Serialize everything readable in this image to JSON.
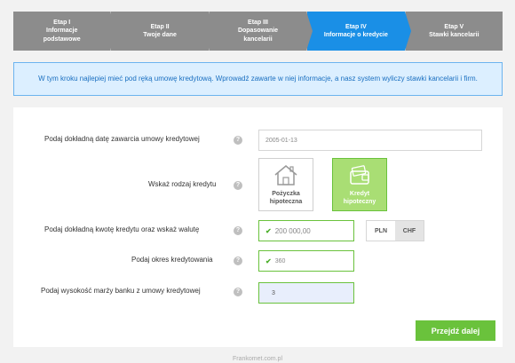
{
  "steps": [
    {
      "num": "Etap I",
      "title": "Informacje podstawowe"
    },
    {
      "num": "Etap II",
      "title": "Twoje dane"
    },
    {
      "num": "Etap III",
      "title": "Dopasowanie kancelarii"
    },
    {
      "num": "Etap IV",
      "title": "Informacje o kredycie"
    },
    {
      "num": "Etap V",
      "title": "Stawki kancelarii"
    }
  ],
  "info_text": "W tym kroku najlepiej mieć pod ręką umowę kredytową. Wprowadź zawarte w niej informacje, a nasz system wyliczy stawki kancelarii i firm.",
  "form": {
    "date_label": "Podaj dokładną datę zawarcia umowy kredytowej",
    "date_value": "2005-01-13",
    "credit_type_label": "Wskaż rodzaj kredytu",
    "options": [
      {
        "label": "Pożyczka hipoteczna",
        "icon": "house-icon",
        "selected": false
      },
      {
        "label": "Kredyt hipoteczny",
        "icon": "wallet-icon",
        "selected": true
      }
    ],
    "amount_label": "Podaj dokładną kwotę kredytu oraz wskaż walutę",
    "amount_value": "200 000,00",
    "currencies": [
      "PLN",
      "CHF"
    ],
    "selected_currency": "CHF",
    "period_label": "Podaj okres kredytowania",
    "period_value": "360",
    "margin_label": "Podaj wysokość marży banku z umowy kredytowej",
    "margin_value": "3",
    "help_symbol": "?",
    "next_label": "Przejdź dalej"
  },
  "colors": {
    "active_step": "#1a8fe6",
    "inactive_step": "#8c8c8c",
    "accent_green": "#6ac23c"
  },
  "footer": "Frankomet.com.pl"
}
